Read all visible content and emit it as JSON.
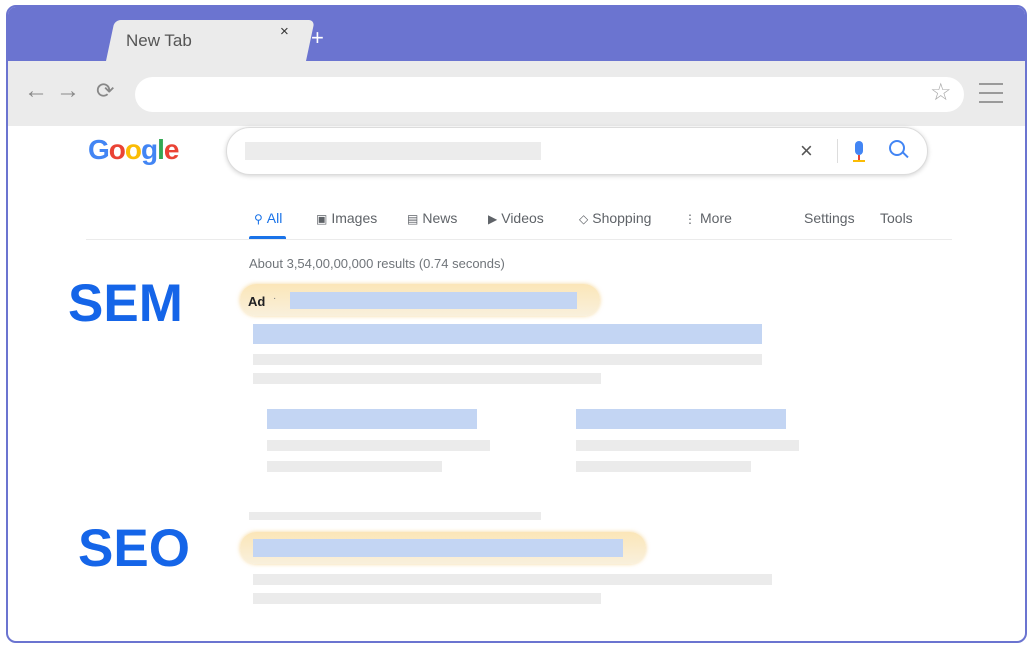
{
  "browser": {
    "tab_title": "New Tab",
    "tab_close": "×",
    "new_tab": "+",
    "back": "←",
    "forward": "→",
    "reload": "⟳",
    "star": "☆",
    "icons": [
      "back-arrow-icon",
      "forward-arrow-icon",
      "reload-icon",
      "star-icon",
      "menu-icon"
    ],
    "accent": "#6b74d0"
  },
  "google": {
    "logo_letters": [
      {
        "ch": "G",
        "color": "#4285f4"
      },
      {
        "ch": "o",
        "color": "#ea4335"
      },
      {
        "ch": "o",
        "color": "#fbbc05"
      },
      {
        "ch": "g",
        "color": "#4285f4"
      },
      {
        "ch": "l",
        "color": "#34a853"
      },
      {
        "ch": "e",
        "color": "#ea4335"
      }
    ],
    "clear": "×",
    "search_icons": [
      "clear-icon",
      "mic-icon",
      "search-icon"
    ]
  },
  "tabs": {
    "all": "All",
    "images": "Images",
    "news": "News",
    "videos": "Videos",
    "shopping": "Shopping",
    "more": "More",
    "settings": "Settings",
    "tools": "Tools"
  },
  "results": {
    "stats": "About 3,54,00,00,000 results (0.74 seconds)",
    "ad_label": "Ad",
    "ad_dot": "·"
  },
  "labels": {
    "sem": "SEM",
    "seo": "SEO"
  }
}
